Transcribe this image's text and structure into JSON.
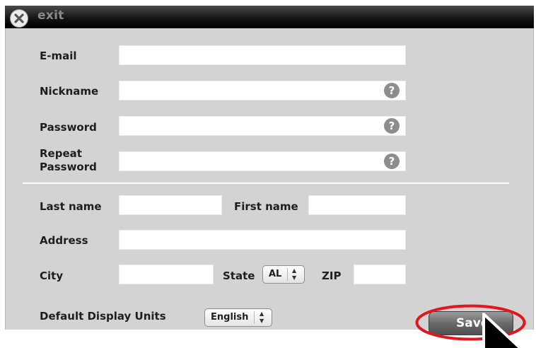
{
  "window": {
    "exit_label": "exit"
  },
  "account": {
    "email_label": "E-mail",
    "email_value": "",
    "nickname_label": "Nickname",
    "nickname_value": "",
    "password_label": "Password",
    "password_value": "",
    "repeat_label_line1": "Repeat",
    "repeat_label_line2": "Password",
    "repeat_value": "",
    "help_glyph": "?"
  },
  "personal": {
    "last_name_label": "Last name",
    "last_name_value": "",
    "first_name_label": "First name",
    "first_name_value": "",
    "address_label": "Address",
    "address_value": "",
    "city_label": "City",
    "city_value": "",
    "state_label": "State",
    "state_value": "AL",
    "zip_label": "ZIP",
    "zip_value": ""
  },
  "preferences": {
    "units_label": "Default Display Units",
    "units_value": "English"
  },
  "actions": {
    "save_label": "Save"
  },
  "icons": {
    "close": "close-icon",
    "help": "help-icon",
    "stepper": "up-down-arrows-icon",
    "pointer": "mouse-pointer-icon"
  },
  "colors": {
    "panel_bg": "#d3d3d3",
    "titlebar_bg": "#151515",
    "highlight_ring": "#e0171f",
    "save_button_bg": "#6a6a6a"
  }
}
